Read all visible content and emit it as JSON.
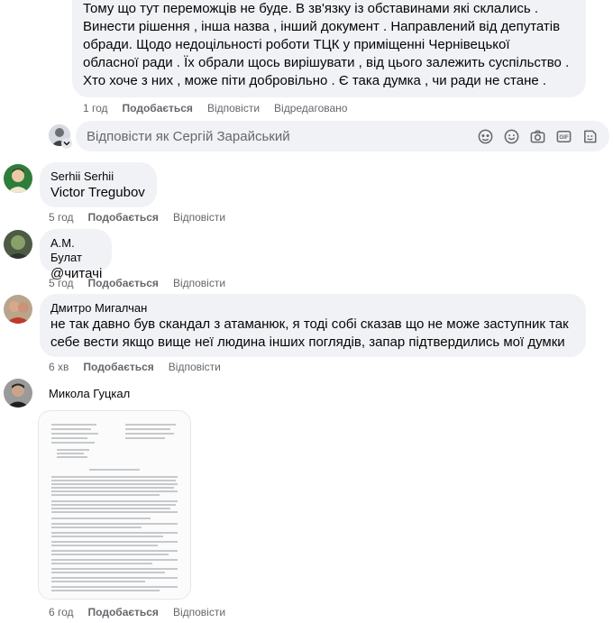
{
  "top_comment": {
    "lines": [
      "Тому що тут переможців не буде. В зв'язку із обставинами які склались .",
      "Винести рішення , інша назва , інший документ . Направлений від депутатів",
      "обради. Щодо недоцільності роботи ТЦК у приміщенні Чернівецької",
      "обласної ради . Їх обрали щось вирішувати , від цього залежить суспільство .",
      "Хто хоче з них , може піти добровільно . Є така думка , чи ради не стане ."
    ],
    "meta": {
      "time": "1 год",
      "like": "Подобається",
      "reply": "Відповісти",
      "edited": "Відредаговано"
    }
  },
  "reply_box": {
    "placeholder": "Відповісти як Сергій Зарайський",
    "icons": [
      "avatar-sticker-icon",
      "emoji-icon",
      "camera-icon",
      "gif-icon",
      "sticker-icon"
    ]
  },
  "comments": [
    {
      "author": "Serhii Serhii",
      "text": "Victor Tregubov",
      "time": "5 год",
      "like": "Подобається",
      "reply": "Відповісти"
    },
    {
      "author": "А.М. Булат",
      "text": "@читачі",
      "time": "5 год",
      "like": "Подобається",
      "reply": "Відповісти"
    },
    {
      "author": "Дмитро Мигалчан",
      "text_lines": [
        "не так давно був скандал з атаманюк, я тоді собі сказав що не може заступник так",
        "себе вести якщо вище неї людина інших поглядів, запар підтвердились мої думки"
      ],
      "time": "6 хв",
      "like": "Подобається",
      "reply": "Відповісти"
    },
    {
      "author": "Микола Гуцкал",
      "time": "6 год",
      "like": "Подобається",
      "reply": "Відповісти"
    }
  ],
  "colors": {
    "bubble": "#f0f2f5",
    "meta": "#65676b",
    "text": "#050505"
  }
}
